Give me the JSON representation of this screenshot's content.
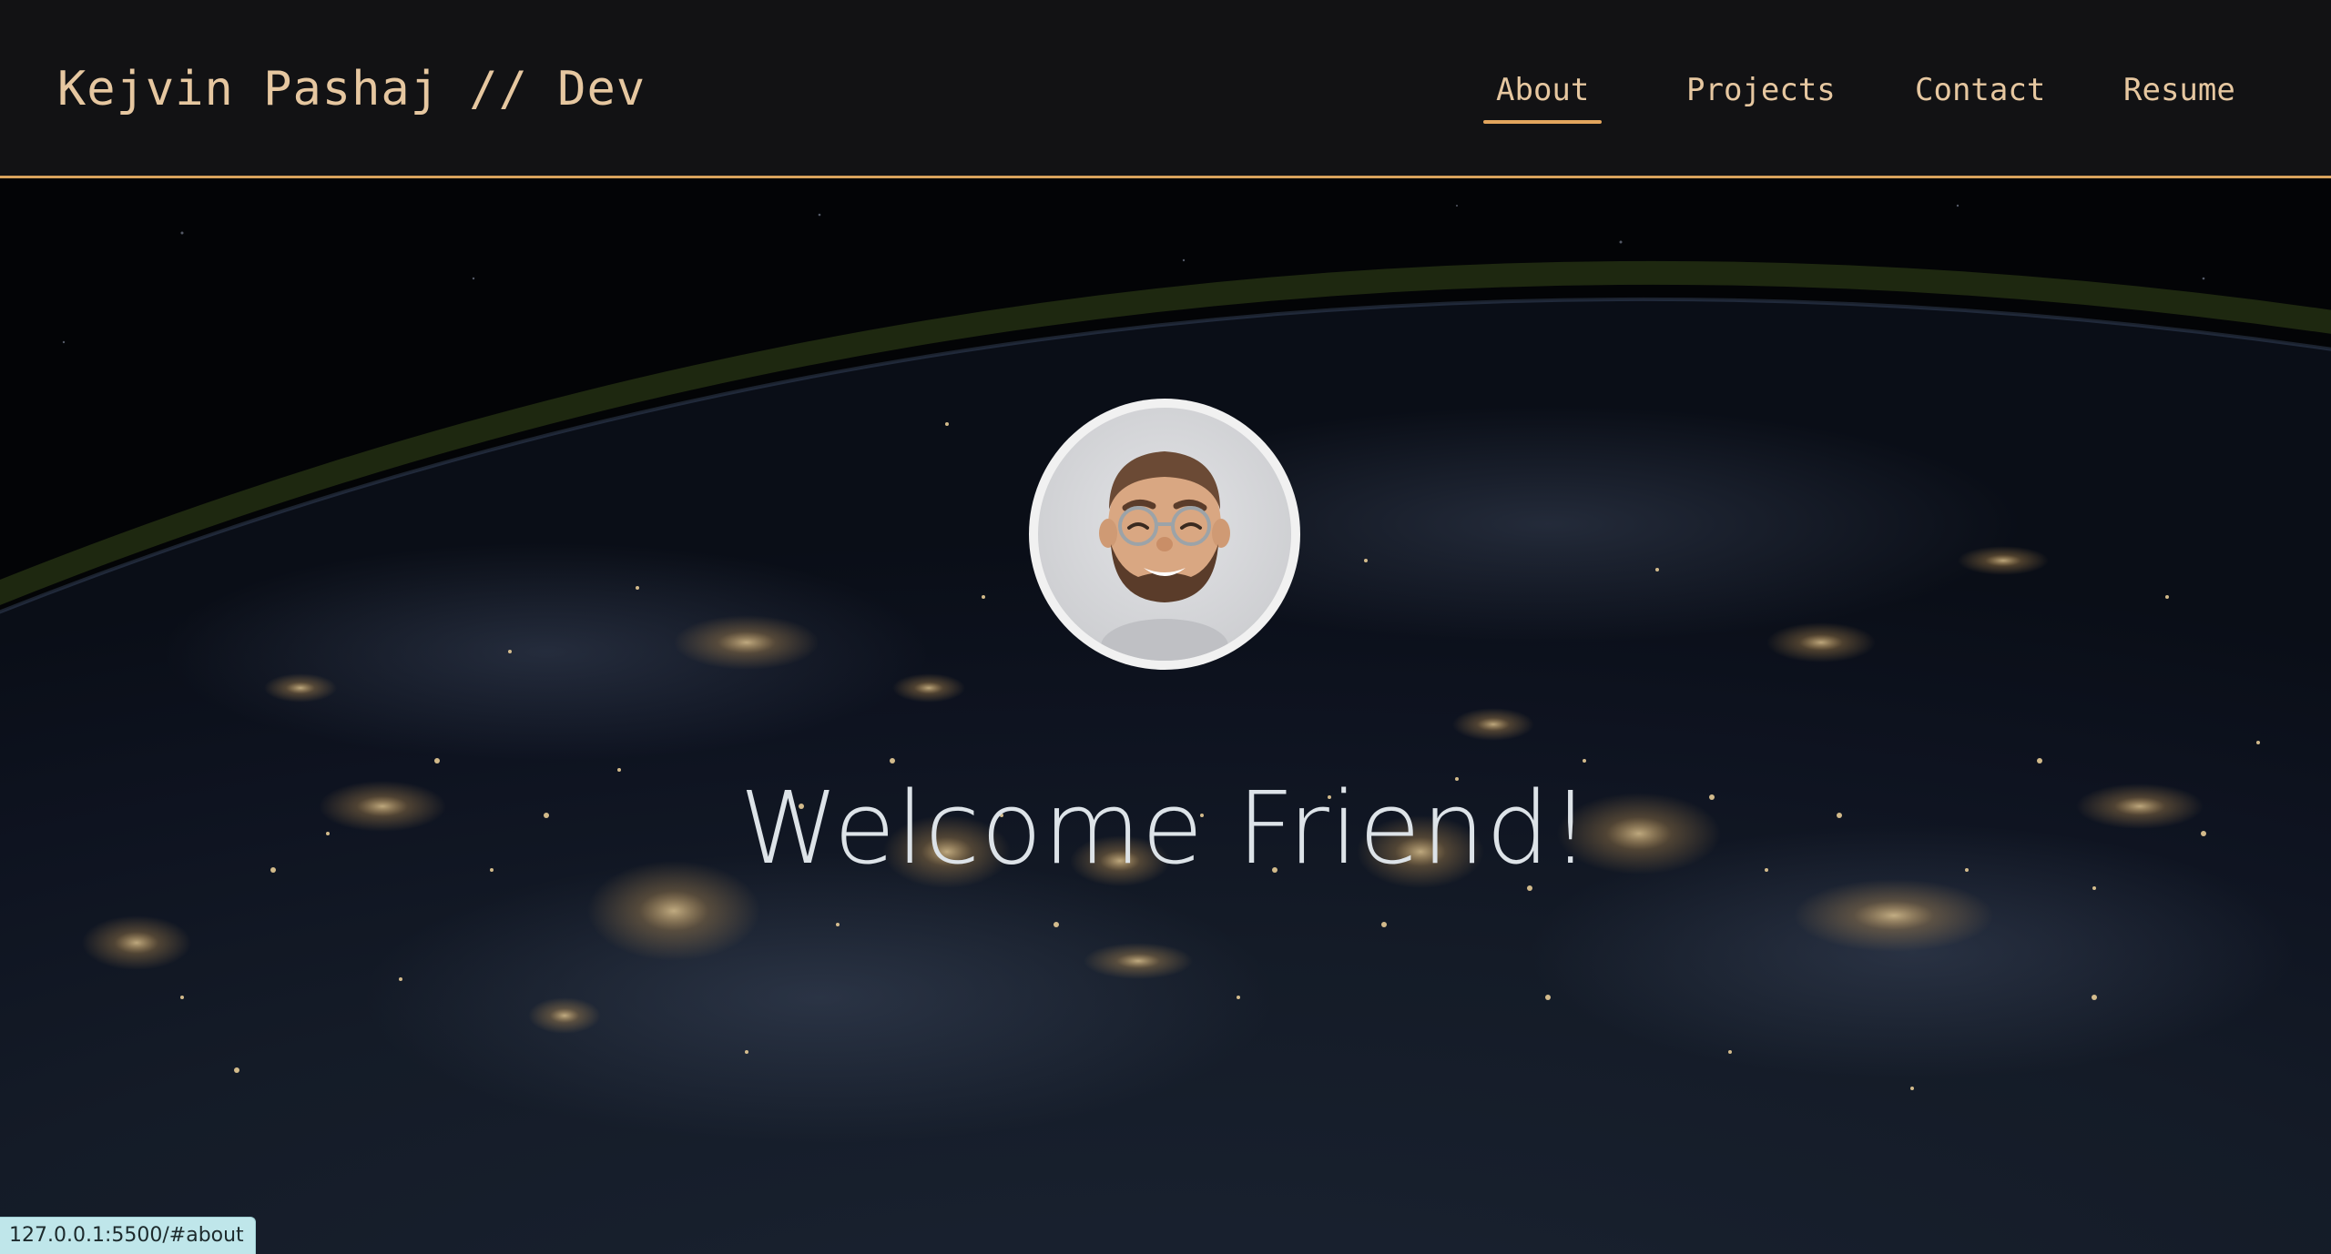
{
  "header": {
    "brand": "Kejvin Pashaj // Dev",
    "nav": [
      {
        "label": "About",
        "active": true
      },
      {
        "label": "Projects",
        "active": false
      },
      {
        "label": "Contact",
        "active": false
      },
      {
        "label": "Resume",
        "active": false
      }
    ]
  },
  "hero": {
    "background": "earth-at-night-from-space",
    "avatar": "memoji-avatar",
    "heading": "Welcome Friend!"
  },
  "status_bar": {
    "url": "127.0.0.1:5500/#about"
  },
  "colors": {
    "accent": "#e3a55d",
    "nav_text": "#e6c7a0",
    "header_bg": "#121214",
    "heading_text": "#dde3e8"
  }
}
